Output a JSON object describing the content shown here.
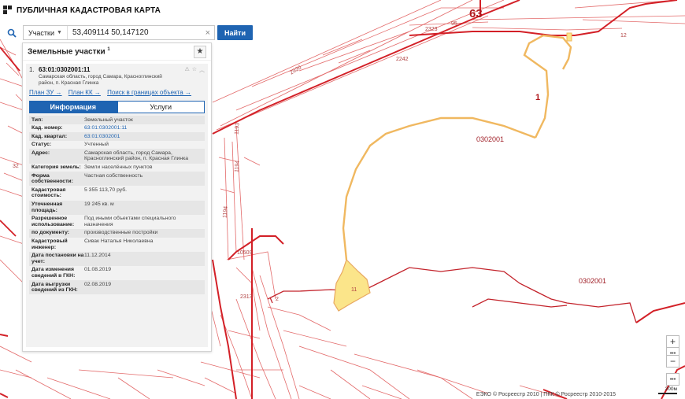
{
  "app": {
    "title": "ПУБЛИЧНАЯ КАДАСТРОВАЯ КАРТА"
  },
  "search": {
    "type_label": "Участки",
    "query": "53,409114 50,147120",
    "clear": "×",
    "button": "Найти"
  },
  "panel": {
    "title": "Земельные участки",
    "title_sup": "1",
    "item": {
      "num": "1.",
      "cad_number": "63:01:0302001:11",
      "address": "Самарская область, город Самара, Красноглинский район, п. Красная Глинка"
    },
    "links": [
      "План ЗУ →",
      "План КК →",
      "Поиск в границах объекта →"
    ],
    "tabs": [
      "Информация",
      "Услуги"
    ],
    "props": [
      {
        "k": "Тип:",
        "v": "Земельный участок"
      },
      {
        "k": "Кад. номер:",
        "v": "63:01:0302001:11",
        "link": true
      },
      {
        "k": "Кад. квартал:",
        "v": "63:01:0302001",
        "link": true
      },
      {
        "k": "Статус:",
        "v": "Учтенный"
      },
      {
        "k": "Адрес:",
        "v": "Самарская область, город Самара, Красноглинский район, п. Красная Глинка"
      },
      {
        "k": "Категория земель:",
        "v": "Земли населённых пунктов"
      },
      {
        "k": "Форма собственности:",
        "v": "Частная собственность"
      },
      {
        "k": "Кадастровая стоимость:",
        "v": "5 355 113,70 руб."
      },
      {
        "k": "Уточненная площадь:",
        "v": "19 245 кв. м"
      },
      {
        "k": "Разрешенное использование:",
        "v": "Под иными объектами специального назначения"
      },
      {
        "k": "по документу:",
        "v": "производственные постройки"
      },
      {
        "k": "Кадастровый инженер:",
        "v": "Сивак Наталья Николаевна"
      },
      {
        "k": "Дата постановки на учет:",
        "v": "11.12.2014"
      },
      {
        "k": "Дата изменения сведений в ГКН:",
        "v": "01.08.2019"
      },
      {
        "k": "Дата выгрузки сведений из ГКН:",
        "v": "02.08.2019"
      }
    ]
  },
  "map": {
    "labels": {
      "district": "63",
      "parcel_num": "1",
      "quarter_a": "0302001",
      "quarter_b": "0302001",
      "l_2242": "2242",
      "l_2323": "2323",
      "l_1193": "1193",
      "l_1194": "1194",
      "l_1194b": "1194",
      "l_2313": "2313",
      "l_2920": "2920",
      "l_10509": "10509",
      "l_11": "11",
      "l_12": "12",
      "l_32": "32",
      "l_95": "95",
      "l_2": "2"
    }
  },
  "controls": {
    "zoom_in": "+",
    "more": "•••",
    "zoom_out": "−",
    "more2": "•••"
  },
  "attribution": "ЕЭКО © Росреестр 2010 | ПКК © Росреестр 2010-2015",
  "scale": "200м",
  "colors": {
    "accent": "#1f64b2",
    "boundary": "#d32027",
    "parcel_fill": "#fbe58a",
    "parcel_outline": "#f0b860"
  }
}
